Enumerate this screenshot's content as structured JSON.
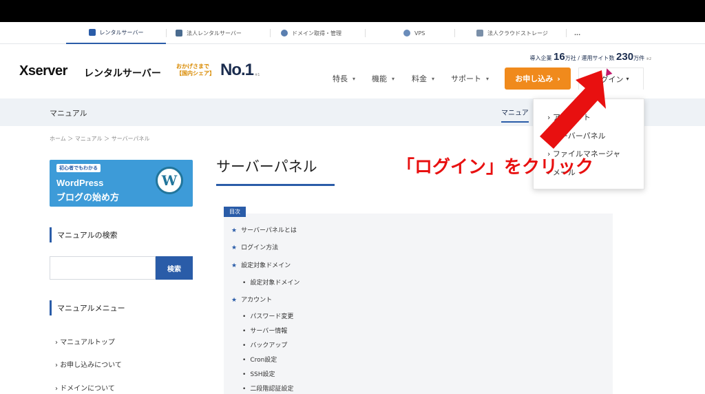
{
  "service_tabs": [
    {
      "label": "レンタルサーバー",
      "active": true
    },
    {
      "label": "法人レンタルサーバー"
    },
    {
      "label": "ドメイン取得・管理"
    },
    {
      "label": "VPS"
    },
    {
      "label": "法人クラウドストレージ"
    },
    {
      "label": "..."
    }
  ],
  "header": {
    "logo_brand": "Xserver",
    "logo_product": "レンタルサーバー",
    "no1_sub_line1": "おかげさまで",
    "no1_sub_line2": "【国内シェア】",
    "no1": "No.1",
    "no1_note": "※1",
    "stats_prefix1": "導入企業",
    "stats_value1": "16",
    "stats_unit1": "万社 / 運用サイト数",
    "stats_value2": "230",
    "stats_unit2": "万件",
    "stats_note": "※2",
    "nav": [
      "特長",
      "機能",
      "料金",
      "サポート"
    ],
    "apply_label": "お申し込み",
    "login_label": "ログイン"
  },
  "subbar": {
    "title": "マニュアル",
    "active_tab": "マニュア"
  },
  "breadcrumb": "ホーム ＞ マニュアル ＞ サーバーパネル",
  "sidebar": {
    "banner_tag": "初心者でもわかる",
    "banner_line1": "WordPress",
    "banner_line2": "ブログの始め方",
    "search_heading": "マニュアルの検索",
    "search_button": "検索",
    "menu_heading": "マニュアルメニュー",
    "menu_links": [
      "マニュアルトップ",
      "お申し込みについて",
      "ドメインについて"
    ]
  },
  "main": {
    "title": "サーバーパネル",
    "toc_label": "目次",
    "toc": [
      {
        "text": "サーバーパネルとは",
        "level": 1
      },
      {
        "text": "ログイン方法",
        "level": 1
      },
      {
        "text": "設定対象ドメイン",
        "level": 1
      },
      {
        "text": "設定対象ドメイン",
        "level": 2
      },
      {
        "text": "アカウント",
        "level": 1
      },
      {
        "text": "パスワード変更",
        "level": 2
      },
      {
        "text": "サーバー情報",
        "level": 2
      },
      {
        "text": "バックアップ",
        "level": 2
      },
      {
        "text": "Cron設定",
        "level": 2
      },
      {
        "text": "SSH設定",
        "level": 2
      },
      {
        "text": "二段階認証設定",
        "level": 2
      }
    ]
  },
  "login_dropdown": {
    "items": [
      "アカウント",
      "サーバーパネル",
      "ファイルマネージャ",
      "メール"
    ]
  },
  "annotation": "「ログイン」をクリック",
  "colors": {
    "accent": "#2a5ca8",
    "apply": "#f08a1c",
    "annotation": "#e81010"
  }
}
